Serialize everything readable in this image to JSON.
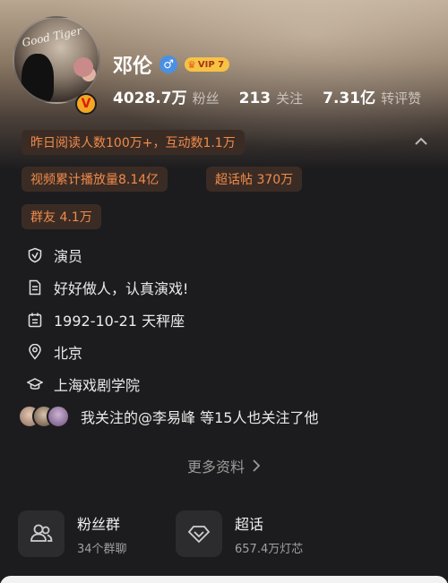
{
  "profile": {
    "name": "邓伦",
    "gender_symbol": "♂",
    "vip_label": "VIP 7",
    "verified_symbol": "V",
    "avatar_signature": "Good Tiger",
    "stats": [
      {
        "value": "4028.7万",
        "label": "粉丝"
      },
      {
        "value": "213",
        "label": "关注"
      },
      {
        "value": "7.31亿",
        "label": "转评赞"
      }
    ]
  },
  "tags": {
    "yesterday": "昨日阅读人数100万+，互动数1.1万",
    "video_plays": "视频累计播放量8.14亿",
    "super_topic_posts": "超话帖 370万",
    "group_friends": "群友 4.1万"
  },
  "info": {
    "occupation": "演员",
    "bio": "好好做人，认真演戏!",
    "birthday": "1992-10-21 天秤座",
    "location": "北京",
    "school": "上海戏剧学院"
  },
  "friends_text": "我关注的@李易峰 等15人也关注了他",
  "more_info_label": "更多资料",
  "cards": {
    "fan_group": {
      "title": "粉丝群",
      "subtitle": "34个群聊"
    },
    "super_topic": {
      "title": "超话",
      "subtitle": "657.4万灯芯"
    }
  },
  "colors": {
    "tag_text": "#f28a4a",
    "tag_bg": "#3a2c25",
    "background": "#1c1c1e"
  }
}
